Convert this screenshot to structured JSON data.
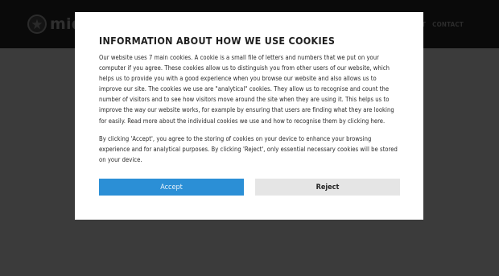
{
  "header": {
    "logo_text": "midv",
    "nav": [
      "ENT",
      "CONTACT"
    ]
  },
  "cookie_modal": {
    "title": "INFORMATION ABOUT HOW WE USE COOKIES",
    "paragraph_1": "Our website uses 7 main cookies. A cookie is a small file of letters and numbers that we put on your computer if you agree. These cookies allow us to distinguish you from other users of our website, which helps us to provide you with a good experience when you browse our website and also allows us to improve our site. The cookies we use are \"analytical\" cookies. They allow us to recognise and count the number of visitors and to see how visitors move around the site when they are using it. This helps us to improve the way our website works, for example by ensuring that users are finding what they are looking for easily. Read more about the individual cookies we use and how to recognise them by clicking here.",
    "paragraph_2": "By clicking 'Accept', you agree to the storing of cookies on your device to enhance your browsing experience and for analytical purposes. By clicking 'Reject', only essential necessary cookies will be stored on your device.",
    "accept_label": "Accept",
    "reject_label": "Reject"
  },
  "colors": {
    "accept_button": "#2b8fd6",
    "reject_button": "#e5e5e5",
    "backdrop": "#3a3a3a"
  }
}
